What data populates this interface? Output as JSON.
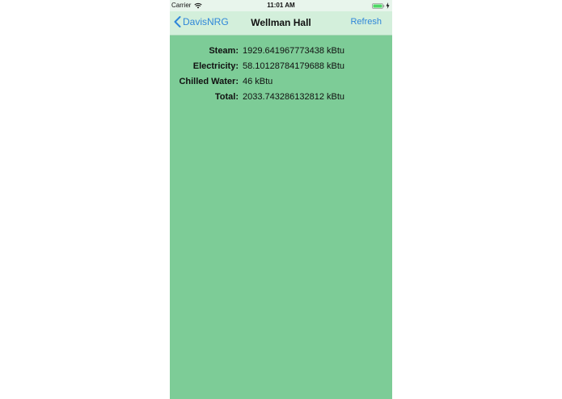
{
  "status_bar": {
    "carrier": "Carrier",
    "time": "11:01 AM",
    "wifi_icon": "wifi-icon",
    "battery_icon": "battery-charging-icon",
    "battery_color": "#4cd964"
  },
  "nav_bar": {
    "back_label": "DavisNRG",
    "back_icon": "chevron-left-icon",
    "title": "Wellman Hall",
    "refresh_label": "Refresh",
    "accent_color": "#2f86d9"
  },
  "energy": {
    "rows": [
      {
        "label": "Steam:",
        "value": "1929.641967773438 kBtu"
      },
      {
        "label": "Electricity:",
        "value": "58.10128784179688 kBtu"
      },
      {
        "label": "Chilled Water:",
        "value": "46 kBtu"
      },
      {
        "label": "Total:",
        "value": "2033.743286132812 kBtu"
      }
    ]
  },
  "background_color": "#7dcc97"
}
